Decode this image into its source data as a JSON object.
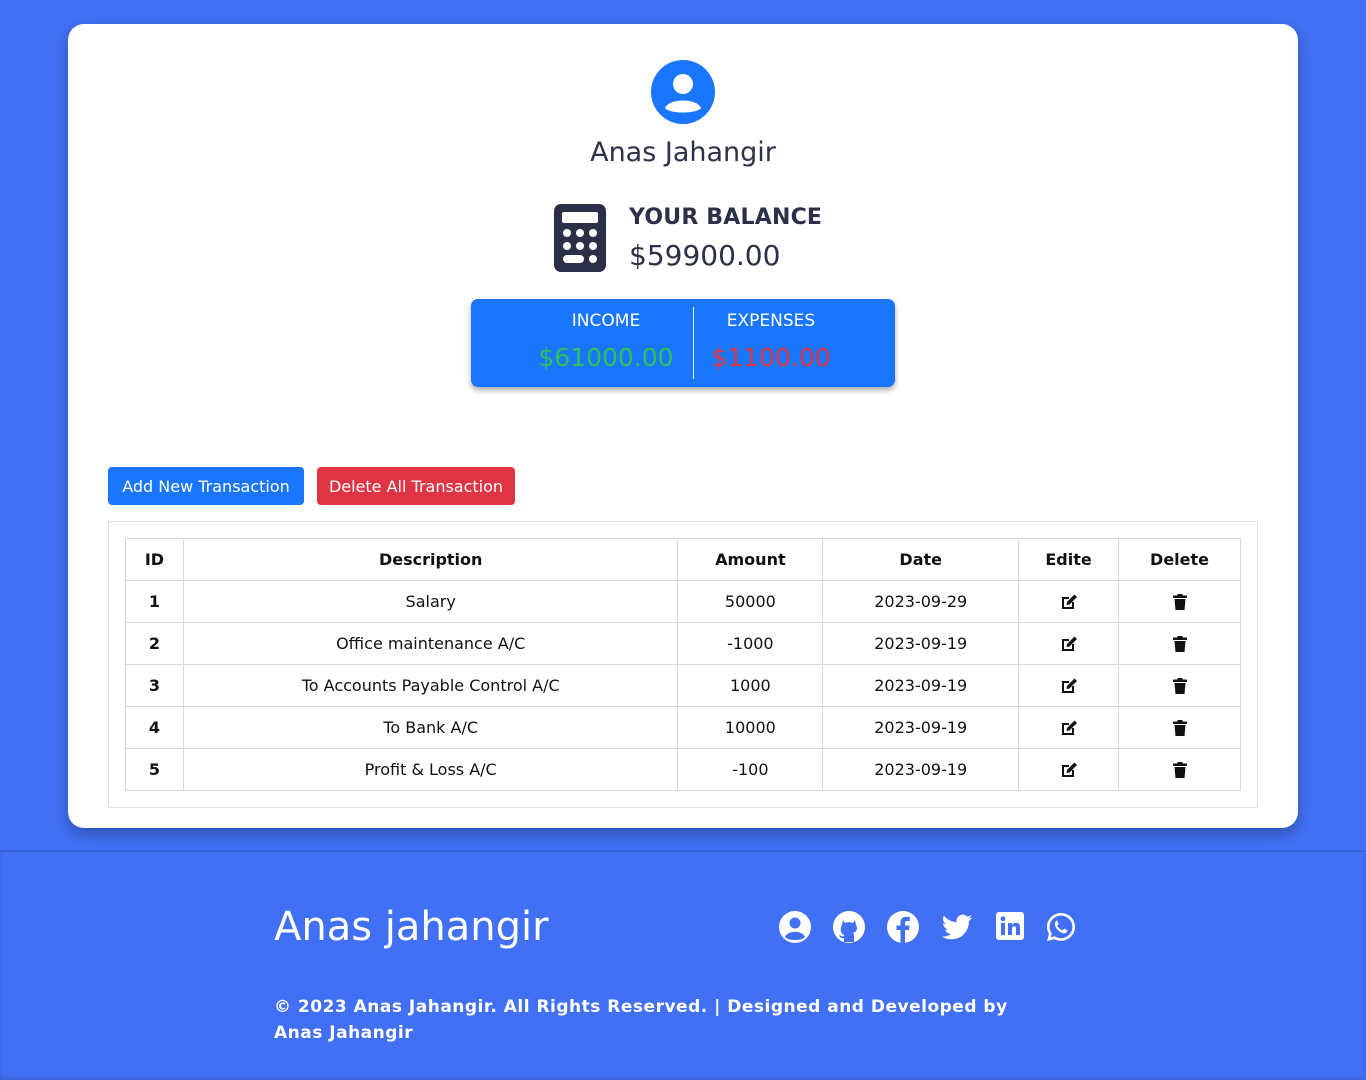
{
  "profile": {
    "name": "Anas Jahangir",
    "avatar_icon": "user-circle-icon"
  },
  "balance": {
    "label": "YOUR BALANCE",
    "value": "$59900.00",
    "icon": "calculator-icon"
  },
  "summary": {
    "income_label": "INCOME",
    "income_value": "$61000.00",
    "expense_label": "EXPENSES",
    "expense_value": "$1100.00",
    "income_color": "#2cc25a",
    "expense_color": "#e0323f"
  },
  "actions": {
    "add_label": "Add New Transaction",
    "delete_all_label": "Delete All Transaction"
  },
  "table": {
    "headers": [
      "ID",
      "Description",
      "Amount",
      "Date",
      "Edite",
      "Delete"
    ],
    "rows": [
      {
        "id": "1",
        "description": "Salary",
        "amount": "50000",
        "date": "2023-09-29"
      },
      {
        "id": "2",
        "description": "Office maintenance A/C",
        "amount": "-1000",
        "date": "2023-09-19"
      },
      {
        "id": "3",
        "description": "To Accounts Payable Control A/C",
        "amount": "1000",
        "date": "2023-09-19"
      },
      {
        "id": "4",
        "description": "To Bank A/C",
        "amount": "10000",
        "date": "2023-09-19"
      },
      {
        "id": "5",
        "description": "Profit & Loss A/C",
        "amount": "-100",
        "date": "2023-09-19"
      }
    ]
  },
  "footer": {
    "name": "Anas jahangir",
    "copyright": "© 2023 Anas Jahangir. All Rights Reserved. | Designed and Developed by Anas Jahangir",
    "social_icons": [
      "user-circle-icon",
      "github-icon",
      "facebook-icon",
      "twitter-icon",
      "linkedin-icon",
      "whatsapp-icon"
    ]
  },
  "colors": {
    "page_bg": "#4270f4",
    "primary": "#1a76ff",
    "danger": "#de3444"
  }
}
